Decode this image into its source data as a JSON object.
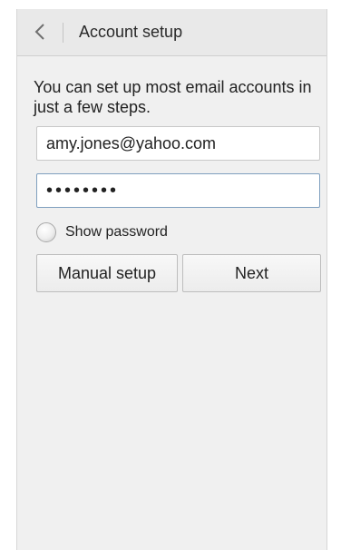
{
  "header": {
    "title": "Account setup",
    "back_icon": "chevron-left-icon"
  },
  "intro_text": "You can set up most email accounts in just a few steps.",
  "form": {
    "email_value": "amy.jones@yahoo.com",
    "password_value": "••••••••",
    "show_password_label": "Show password",
    "show_password_checked": false
  },
  "buttons": {
    "manual_setup": "Manual setup",
    "next": "Next"
  },
  "colors": {
    "background": "#f0f0f0",
    "header": "#e9e9e9",
    "focused_field_border": "#7f9fbf"
  }
}
